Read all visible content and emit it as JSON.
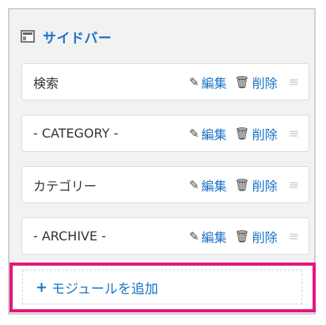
{
  "panel": {
    "title": "サイドバー",
    "title_icon": "widget-layout-icon"
  },
  "modules": [
    {
      "name": "検索",
      "edit_label": "編集",
      "delete_label": "削除"
    },
    {
      "name": "- CATEGORY -",
      "edit_label": "編集",
      "delete_label": "削除"
    },
    {
      "name": "カテゴリー",
      "edit_label": "編集",
      "delete_label": "削除"
    },
    {
      "name": "- ARCHIVE -",
      "edit_label": "編集",
      "delete_label": "削除"
    }
  ],
  "add_module": {
    "plus": "+",
    "label": "モジュールを追加"
  },
  "colors": {
    "accent": "#1a73c8",
    "highlight": "#e5177d",
    "panel_bg": "#f2f2f2"
  }
}
